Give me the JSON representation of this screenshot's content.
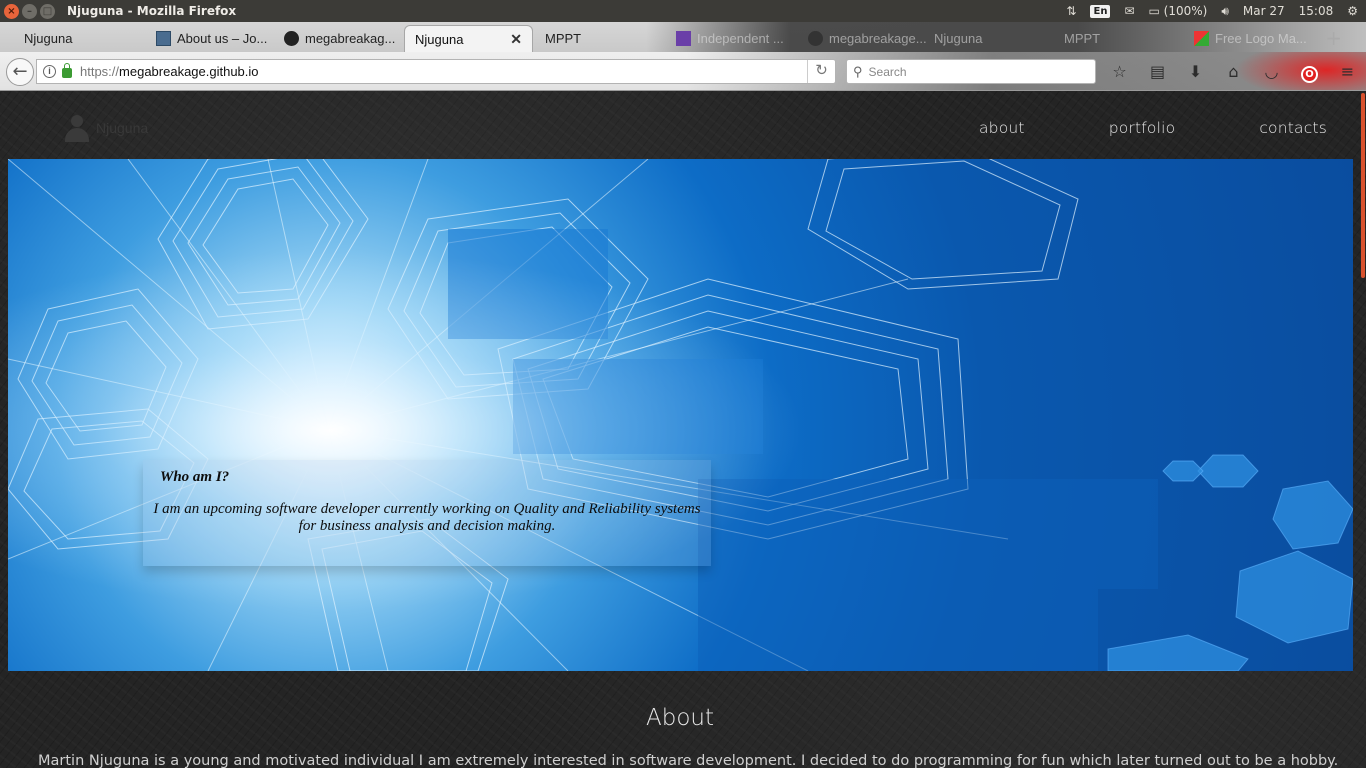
{
  "os_panel": {
    "window_title": "Njuguna - Mozilla Firefox",
    "keyboard_layout": "En",
    "battery": "(100%)",
    "date": "Mar 27",
    "time": "15:08"
  },
  "tabs": [
    {
      "label": "Njuguna",
      "favicon": "none",
      "active": false
    },
    {
      "label": "About us – Jo...",
      "favicon": "page-icon",
      "active": false
    },
    {
      "label": "megabreakag...",
      "favicon": "github-icon",
      "active": false
    },
    {
      "label": "Njuguna",
      "favicon": "none",
      "active": true
    },
    {
      "label": "MPPT",
      "favicon": "none",
      "active": false
    },
    {
      "label": "Independent ...",
      "favicon": "list-icon",
      "active": false
    },
    {
      "label": "megabreakage...",
      "favicon": "github-icon",
      "active": false
    },
    {
      "label": "Njuguna",
      "favicon": "none",
      "active": false
    },
    {
      "label": "MPPT",
      "favicon": "none",
      "active": false
    },
    {
      "label": "Free Logo Ma...",
      "favicon": "logo-icon",
      "active": false
    }
  ],
  "navbar": {
    "url_scheme": "https://",
    "url_host": "megabreakage.github.io",
    "search_placeholder": "Search"
  },
  "site": {
    "brand": "Njuguna",
    "nav": [
      "about",
      "portfolio",
      "contacts"
    ],
    "intro_heading": "Who am I?",
    "intro_text": "I am an upcoming software developer currently working on Quality and Reliability systems for business analysis and decision making.",
    "about_title": "About",
    "about_text": "Martin Njuguna is a young and motivated individual I am extremely interested in software development. I decided to do programming for fun which later turned out to be a hobby. I look"
  },
  "colors": {
    "accent_scrollbar": "#d8522e",
    "hero_blue": "#0a58ae",
    "page_bg": "#242424"
  }
}
